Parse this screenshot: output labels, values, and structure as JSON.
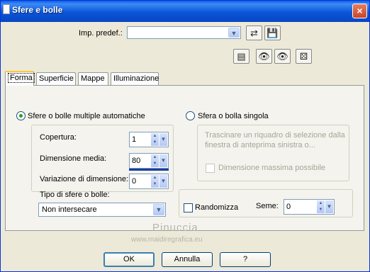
{
  "window": {
    "title": "Sfere e bolle",
    "close": "×"
  },
  "preset": {
    "label": "Imp. predef.:",
    "value": ""
  },
  "icons": {
    "save_preset": "💾",
    "load_preset": "⇄",
    "reset": "▤",
    "randomize": "⚄",
    "preview_a": "👁",
    "preview_b": "👁"
  },
  "tabs": [
    {
      "label": "Forma"
    },
    {
      "label": "Superficie"
    },
    {
      "label": "Mappe"
    },
    {
      "label": "Illuminazione"
    }
  ],
  "left": {
    "radio_label": "Sfere o bolle multiple automatiche",
    "coverage_label": "Copertura:",
    "coverage_value": "1",
    "size_label": "Dimensione media:",
    "size_value": "80",
    "variation_label": "Variazione di dimensione:",
    "variation_value": "0",
    "type_label": "Tipo di sfere o bolle:",
    "type_value": "Non intersecare"
  },
  "right": {
    "radio_label": "Sfera o bolla singola",
    "hint": "Trascinare un riquadro di selezione dalla finestra di anteprima sinistra o...",
    "max_size_label": "Dimensione massima possibile",
    "randomize_label": "Randomizza",
    "seed_label": "Seme:",
    "seed_value": "0"
  },
  "buttons": {
    "ok": "OK",
    "cancel": "Annulla",
    "help": "?"
  },
  "watermark": {
    "line1": "Pinuccia",
    "line2": "www.maidiregrafica.eu"
  }
}
